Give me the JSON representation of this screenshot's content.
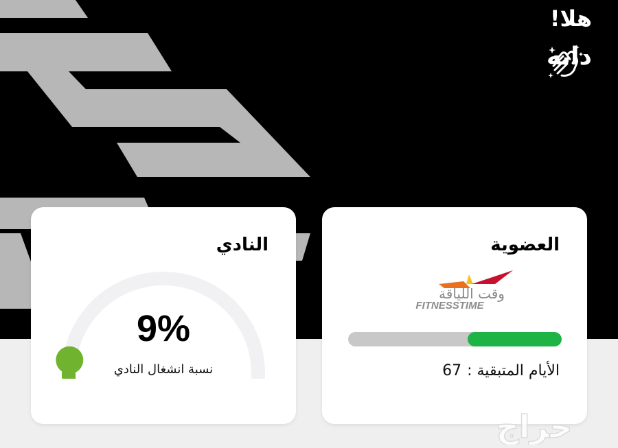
{
  "greeting": {
    "hello": "هلا!",
    "name": "دانه"
  },
  "membership": {
    "title": "العضوية",
    "logo_arabic": "وقت اللياقة",
    "logo_english": "FITNESSTIME",
    "remaining_fraction": 0.44,
    "days_label": "الأيام المتبقية :",
    "days_value": "67",
    "colors": {
      "progress_fill": "#1db345",
      "progress_track": "#c8c8c8"
    }
  },
  "club": {
    "title": "النادي",
    "occupancy_percent": 9,
    "occupancy_text": "9%",
    "occupancy_label": "نسبة انشغال النادي",
    "colors": {
      "indicator": "#6fb32e",
      "gauge_track": "#f1f1f4"
    }
  },
  "watermark": {
    "text": "حراج"
  },
  "icons": {
    "greeting": "clapping-hands-icon"
  }
}
